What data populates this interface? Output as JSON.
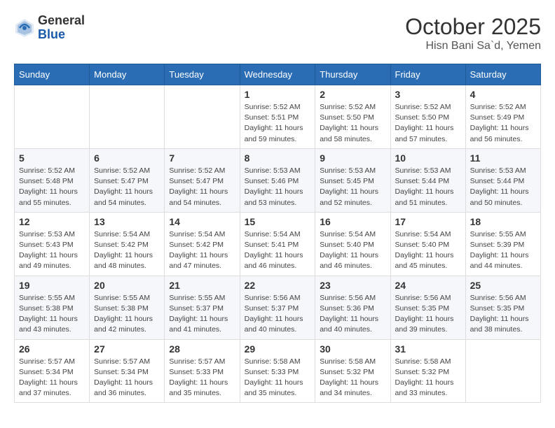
{
  "header": {
    "logo_general": "General",
    "logo_blue": "Blue",
    "month_title": "October 2025",
    "location": "Hisn Bani Sa`d, Yemen"
  },
  "days_of_week": [
    "Sunday",
    "Monday",
    "Tuesday",
    "Wednesday",
    "Thursday",
    "Friday",
    "Saturday"
  ],
  "weeks": [
    [
      {
        "day": "",
        "info": ""
      },
      {
        "day": "",
        "info": ""
      },
      {
        "day": "",
        "info": ""
      },
      {
        "day": "1",
        "info": "Sunrise: 5:52 AM\nSunset: 5:51 PM\nDaylight: 11 hours\nand 59 minutes."
      },
      {
        "day": "2",
        "info": "Sunrise: 5:52 AM\nSunset: 5:50 PM\nDaylight: 11 hours\nand 58 minutes."
      },
      {
        "day": "3",
        "info": "Sunrise: 5:52 AM\nSunset: 5:50 PM\nDaylight: 11 hours\nand 57 minutes."
      },
      {
        "day": "4",
        "info": "Sunrise: 5:52 AM\nSunset: 5:49 PM\nDaylight: 11 hours\nand 56 minutes."
      }
    ],
    [
      {
        "day": "5",
        "info": "Sunrise: 5:52 AM\nSunset: 5:48 PM\nDaylight: 11 hours\nand 55 minutes."
      },
      {
        "day": "6",
        "info": "Sunrise: 5:52 AM\nSunset: 5:47 PM\nDaylight: 11 hours\nand 54 minutes."
      },
      {
        "day": "7",
        "info": "Sunrise: 5:52 AM\nSunset: 5:47 PM\nDaylight: 11 hours\nand 54 minutes."
      },
      {
        "day": "8",
        "info": "Sunrise: 5:53 AM\nSunset: 5:46 PM\nDaylight: 11 hours\nand 53 minutes."
      },
      {
        "day": "9",
        "info": "Sunrise: 5:53 AM\nSunset: 5:45 PM\nDaylight: 11 hours\nand 52 minutes."
      },
      {
        "day": "10",
        "info": "Sunrise: 5:53 AM\nSunset: 5:44 PM\nDaylight: 11 hours\nand 51 minutes."
      },
      {
        "day": "11",
        "info": "Sunrise: 5:53 AM\nSunset: 5:44 PM\nDaylight: 11 hours\nand 50 minutes."
      }
    ],
    [
      {
        "day": "12",
        "info": "Sunrise: 5:53 AM\nSunset: 5:43 PM\nDaylight: 11 hours\nand 49 minutes."
      },
      {
        "day": "13",
        "info": "Sunrise: 5:54 AM\nSunset: 5:42 PM\nDaylight: 11 hours\nand 48 minutes."
      },
      {
        "day": "14",
        "info": "Sunrise: 5:54 AM\nSunset: 5:42 PM\nDaylight: 11 hours\nand 47 minutes."
      },
      {
        "day": "15",
        "info": "Sunrise: 5:54 AM\nSunset: 5:41 PM\nDaylight: 11 hours\nand 46 minutes."
      },
      {
        "day": "16",
        "info": "Sunrise: 5:54 AM\nSunset: 5:40 PM\nDaylight: 11 hours\nand 46 minutes."
      },
      {
        "day": "17",
        "info": "Sunrise: 5:54 AM\nSunset: 5:40 PM\nDaylight: 11 hours\nand 45 minutes."
      },
      {
        "day": "18",
        "info": "Sunrise: 5:55 AM\nSunset: 5:39 PM\nDaylight: 11 hours\nand 44 minutes."
      }
    ],
    [
      {
        "day": "19",
        "info": "Sunrise: 5:55 AM\nSunset: 5:38 PM\nDaylight: 11 hours\nand 43 minutes."
      },
      {
        "day": "20",
        "info": "Sunrise: 5:55 AM\nSunset: 5:38 PM\nDaylight: 11 hours\nand 42 minutes."
      },
      {
        "day": "21",
        "info": "Sunrise: 5:55 AM\nSunset: 5:37 PM\nDaylight: 11 hours\nand 41 minutes."
      },
      {
        "day": "22",
        "info": "Sunrise: 5:56 AM\nSunset: 5:37 PM\nDaylight: 11 hours\nand 40 minutes."
      },
      {
        "day": "23",
        "info": "Sunrise: 5:56 AM\nSunset: 5:36 PM\nDaylight: 11 hours\nand 40 minutes."
      },
      {
        "day": "24",
        "info": "Sunrise: 5:56 AM\nSunset: 5:35 PM\nDaylight: 11 hours\nand 39 minutes."
      },
      {
        "day": "25",
        "info": "Sunrise: 5:56 AM\nSunset: 5:35 PM\nDaylight: 11 hours\nand 38 minutes."
      }
    ],
    [
      {
        "day": "26",
        "info": "Sunrise: 5:57 AM\nSunset: 5:34 PM\nDaylight: 11 hours\nand 37 minutes."
      },
      {
        "day": "27",
        "info": "Sunrise: 5:57 AM\nSunset: 5:34 PM\nDaylight: 11 hours\nand 36 minutes."
      },
      {
        "day": "28",
        "info": "Sunrise: 5:57 AM\nSunset: 5:33 PM\nDaylight: 11 hours\nand 35 minutes."
      },
      {
        "day": "29",
        "info": "Sunrise: 5:58 AM\nSunset: 5:33 PM\nDaylight: 11 hours\nand 35 minutes."
      },
      {
        "day": "30",
        "info": "Sunrise: 5:58 AM\nSunset: 5:32 PM\nDaylight: 11 hours\nand 34 minutes."
      },
      {
        "day": "31",
        "info": "Sunrise: 5:58 AM\nSunset: 5:32 PM\nDaylight: 11 hours\nand 33 minutes."
      },
      {
        "day": "",
        "info": ""
      }
    ]
  ]
}
